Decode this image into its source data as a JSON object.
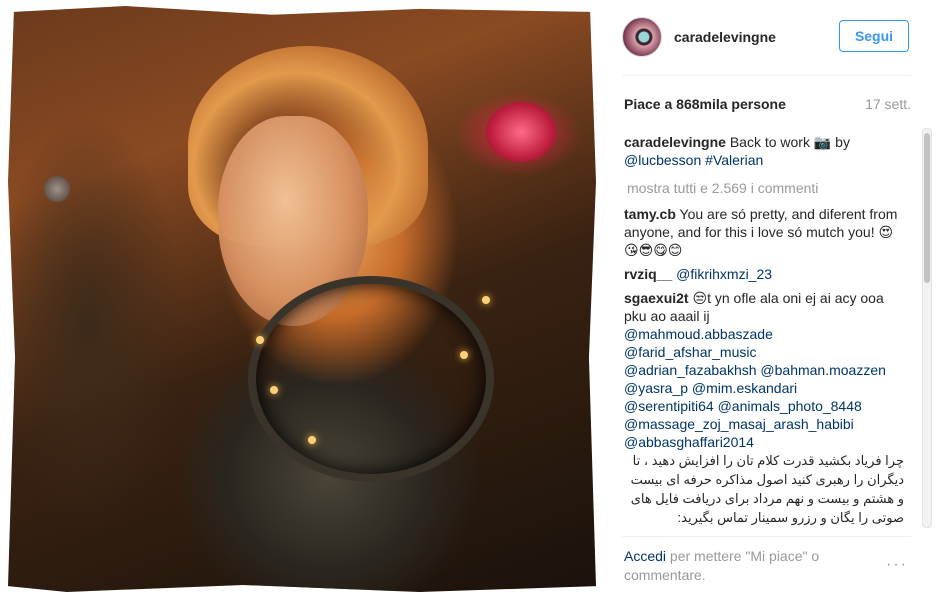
{
  "post": {
    "username": "caradelevingne",
    "follow_label": "Segui",
    "likes": "Piace a 868mila persone",
    "time": "17 sett.",
    "caption_user": "caradelevingne",
    "caption_text": "Back to work 📷 by",
    "caption_mention1": "@lucbesson",
    "caption_mention2": "#Valerian",
    "show_all": "mostra tutti e 2.569 i commenti"
  },
  "comments": [
    {
      "user": "tamy.cb",
      "text": "You are só pretty, and diferent from anyone, and for this i love só mutch you! 😍😘😎😋😊"
    },
    {
      "user": "rvziq__",
      "mention": "@fikrihxmzi_23"
    },
    {
      "user": "sgaexui2t",
      "text": "😒t yn ofle ala oni ej ai  acy ooa pku ao aaail ij"
    }
  ],
  "mentions": [
    "@mahmoud.abbaszade",
    "@farid_afshar_music",
    "@adrian_fazabakhsh @bahman.moazzen",
    "@yasra_p @mim.eskandari",
    "@serentipiti64 @animals_photo_8448",
    "@massage_zoj_masaj_arash_habibi",
    "@abbasghaffari2014"
  ],
  "persian_text": "چرا فریاد بکشید قدرت کلام تان را افزایش دهید ، تا دیگران را رهبری کنید اصول مذاکره حرفه ای بیست و هشتم و بیست و نهم مرداد برای دریافت فایل های صوتی را یگان و رزرو سمینار تماس بگیرید:",
  "login": {
    "link": "Accedi",
    "text": " per mettere \"Mi piace\" o commentare."
  },
  "more_icon": "···",
  "icons": [
    "avatar",
    "ellipsis-icon"
  ]
}
